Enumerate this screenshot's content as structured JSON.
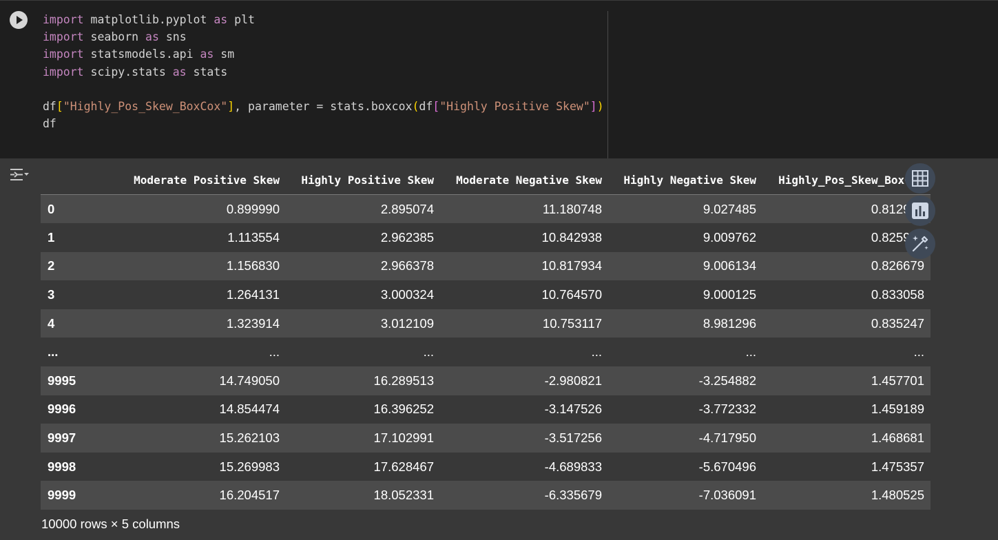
{
  "colors": {
    "code_bg": "#1e1e1e",
    "output_bg": "#383838",
    "row_alt_bg": "#4b4b4b",
    "keyword": "#c586c0",
    "string": "#ce9178",
    "bracket_gold": "#ffd700",
    "bracket_purple": "#da70d6",
    "side_button_bg": "#3f4957"
  },
  "code_cell": {
    "run_icon": "play-icon",
    "lines": [
      {
        "kw": "import",
        "rest": " matplotlib.pyplot ",
        "kw2": "as",
        "end": " plt"
      },
      {
        "kw": "import",
        "rest": " seaborn ",
        "kw2": "as",
        "end": " sns"
      },
      {
        "kw": "import",
        "rest": " statsmodels.api ",
        "kw2": "as",
        "end": " sm"
      },
      {
        "kw": "import",
        "rest": " scipy.stats ",
        "kw2": "as",
        "end": " stats"
      }
    ],
    "assign_line": {
      "lhs_var": "df",
      "lhs_str": "\"Highly_Pos_Skew_BoxCox\"",
      "middle": ", parameter = stats.boxcox",
      "arg_var": "df",
      "arg_str": "\"Highly Positive Skew\""
    },
    "last_line": "df"
  },
  "output": {
    "toggle_icon": "output-toggle-icon",
    "columns": [
      "Moderate Positive Skew",
      "Highly Positive Skew",
      "Moderate Negative Skew",
      "Highly Negative Skew",
      "Highly_Pos_Skew_BoxCox"
    ],
    "rows": [
      {
        "index": "0",
        "values": [
          "0.899990",
          "2.895074",
          "11.180748",
          "9.027485",
          "0.812909"
        ]
      },
      {
        "index": "1",
        "values": [
          "1.113554",
          "2.962385",
          "10.842938",
          "9.009762",
          "0.825921"
        ]
      },
      {
        "index": "2",
        "values": [
          "1.156830",
          "2.966378",
          "10.817934",
          "9.006134",
          "0.826679"
        ]
      },
      {
        "index": "3",
        "values": [
          "1.264131",
          "3.000324",
          "10.764570",
          "9.000125",
          "0.833058"
        ]
      },
      {
        "index": "4",
        "values": [
          "1.323914",
          "3.012109",
          "10.753117",
          "8.981296",
          "0.835247"
        ]
      },
      {
        "index": "...",
        "values": [
          "...",
          "...",
          "...",
          "...",
          "..."
        ]
      },
      {
        "index": "9995",
        "values": [
          "14.749050",
          "16.289513",
          "-2.980821",
          "-3.254882",
          "1.457701"
        ]
      },
      {
        "index": "9996",
        "values": [
          "14.854474",
          "16.396252",
          "-3.147526",
          "-3.772332",
          "1.459189"
        ]
      },
      {
        "index": "9997",
        "values": [
          "15.262103",
          "17.102991",
          "-3.517256",
          "-4.717950",
          "1.468681"
        ]
      },
      {
        "index": "9998",
        "values": [
          "15.269983",
          "17.628467",
          "-4.689833",
          "-5.670496",
          "1.475357"
        ]
      },
      {
        "index": "9999",
        "values": [
          "16.204517",
          "18.052331",
          "-6.335679",
          "-7.036091",
          "1.480525"
        ]
      }
    ],
    "shape_text": "10000 rows × 5 columns",
    "side_buttons": [
      "table-icon",
      "chart-icon",
      "magic-wand-icon"
    ]
  }
}
